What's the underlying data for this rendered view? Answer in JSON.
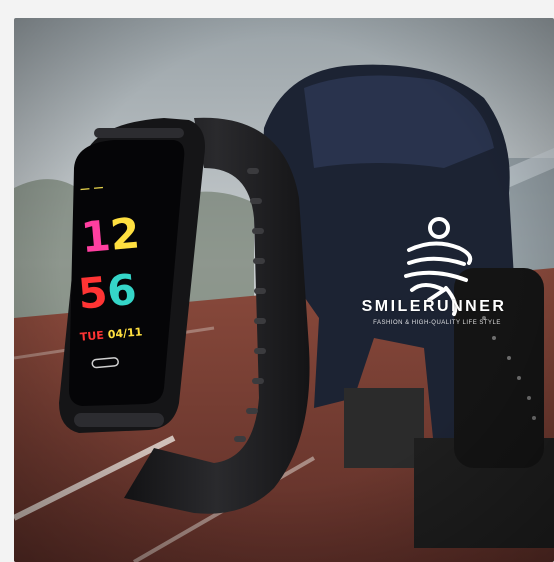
{
  "product_image": {
    "alt": "Smilerunner fitness tracker band over running track photo",
    "watch_display": {
      "hour": "12",
      "minute": "56",
      "day": "TUE",
      "date": "04/11"
    },
    "brand_name": "SMILERUNNER",
    "brand_tagline": "FASHION & HIGH-QUALITY LIFE STYLE"
  },
  "colors": {
    "page_bg": "#f3f3f3",
    "track": "#7a3f34",
    "band": "#1b1b1d",
    "digit_pink": "#ff3fa0",
    "digit_yellow": "#ffe040",
    "digit_red": "#ff3434",
    "digit_teal": "#35d6c8"
  }
}
